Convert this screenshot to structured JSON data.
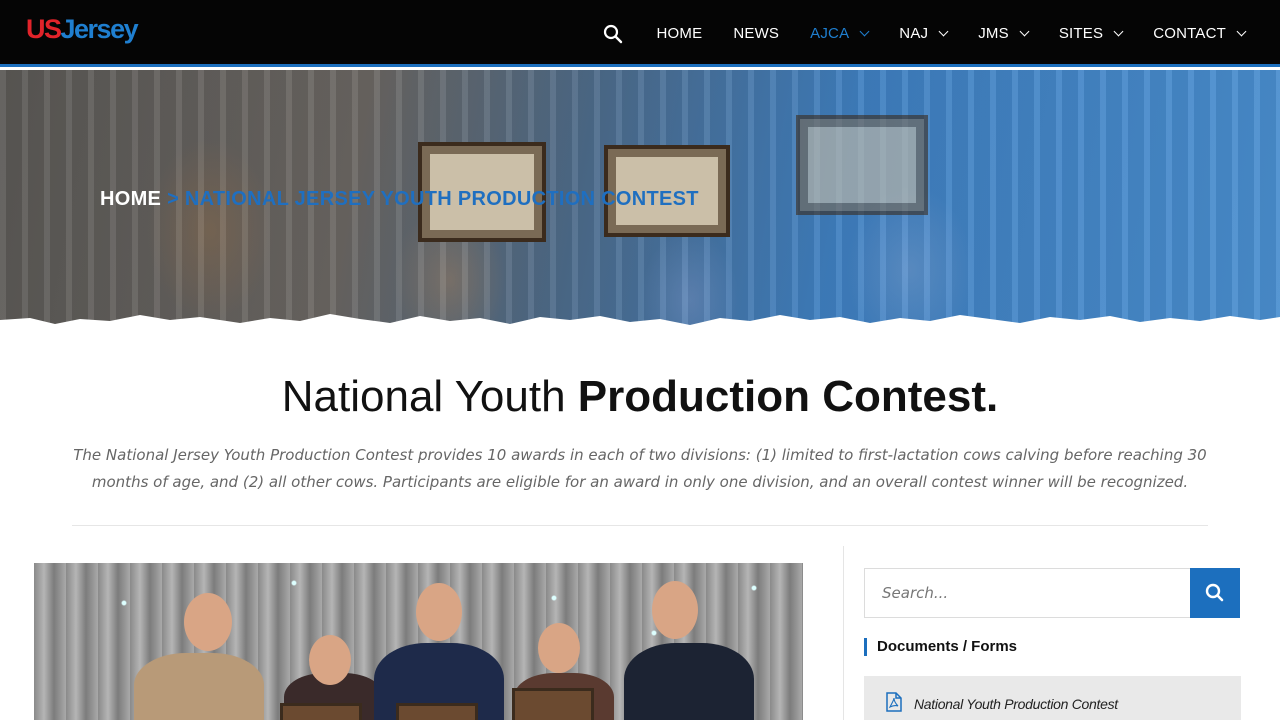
{
  "header": {
    "logo_us": "US",
    "logo_jersey": "Jersey",
    "nav": [
      {
        "label": "HOME",
        "has_dropdown": false,
        "active": false
      },
      {
        "label": "NEWS",
        "has_dropdown": false,
        "active": false
      },
      {
        "label": "AJCA",
        "has_dropdown": true,
        "active": true
      },
      {
        "label": "NAJ",
        "has_dropdown": true,
        "active": false
      },
      {
        "label": "JMS",
        "has_dropdown": true,
        "active": false
      },
      {
        "label": "SITES",
        "has_dropdown": true,
        "active": false
      },
      {
        "label": "CONTACT",
        "has_dropdown": true,
        "active": false
      }
    ]
  },
  "hero": {
    "breadcrumb_home": "HOME",
    "breadcrumb_sep": ">",
    "breadcrumb_current": "NATIONAL JERSEY YOUTH PRODUCTION CONTEST"
  },
  "page": {
    "title_light": "National Youth",
    "title_bold": "Production Contest.",
    "intro": "The National Jersey Youth Production Contest provides 10 awards in each of two divisions: (1) limited to first-lactation cows calving before reaching 30 months of age, and (2) all other cows. Participants are eligible for an award in only one division, and an overall contest winner will be recognized."
  },
  "sidebar": {
    "search_placeholder": "Search...",
    "widget_title": "Documents / Forms",
    "documents": [
      {
        "label": "National Youth Production Contest",
        "icon": "pdf-icon"
      }
    ]
  },
  "colors": {
    "accent": "#1c6fbe",
    "logo_red": "#e2232a",
    "header_bg": "#050505"
  }
}
